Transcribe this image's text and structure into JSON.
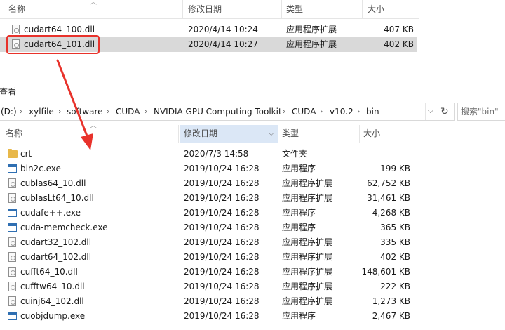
{
  "top_explorer": {
    "columns": {
      "name": "名称",
      "date": "修改日期",
      "type": "类型",
      "size": "大小"
    },
    "rows": [
      {
        "name": "cudart64_100.dll",
        "date": "2020/4/14 10:24",
        "type": "应用程序扩展",
        "size": "407 KB",
        "icon": "dll-file-icon",
        "selected": false
      },
      {
        "name": "cudart64_101.dll",
        "date": "2020/4/14 10:27",
        "type": "应用程序扩展",
        "size": "402 KB",
        "icon": "dll-file-icon",
        "selected": true
      }
    ]
  },
  "ribbon": {
    "view_label": "查看"
  },
  "address": {
    "prefix": "(D:)",
    "crumbs": [
      "xylfile",
      "software",
      "CUDA",
      "NVIDIA GPU Computing Toolkit",
      "CUDA",
      "v10.2",
      "bin"
    ],
    "search_placeholder": "搜索\"bin\""
  },
  "main_list": {
    "columns": {
      "name": "名称",
      "date": "修改日期",
      "type": "类型",
      "size": "大小"
    },
    "rows": [
      {
        "name": "crt",
        "date": "2020/7/3 14:58",
        "type": "文件夹",
        "size": "",
        "icon": "folder-icon"
      },
      {
        "name": "bin2c.exe",
        "date": "2019/10/24 16:28",
        "type": "应用程序",
        "size": "199 KB",
        "icon": "exe-icon"
      },
      {
        "name": "cublas64_10.dll",
        "date": "2019/10/24 16:28",
        "type": "应用程序扩展",
        "size": "62,752 KB",
        "icon": "dll-file-icon"
      },
      {
        "name": "cublasLt64_10.dll",
        "date": "2019/10/24 16:28",
        "type": "应用程序扩展",
        "size": "31,461 KB",
        "icon": "dll-file-icon"
      },
      {
        "name": "cudafe++.exe",
        "date": "2019/10/24 16:28",
        "type": "应用程序",
        "size": "4,268 KB",
        "icon": "exe-icon"
      },
      {
        "name": "cuda-memcheck.exe",
        "date": "2019/10/24 16:28",
        "type": "应用程序",
        "size": "365 KB",
        "icon": "exe-icon"
      },
      {
        "name": "cudart32_102.dll",
        "date": "2019/10/24 16:28",
        "type": "应用程序扩展",
        "size": "335 KB",
        "icon": "dll-file-icon"
      },
      {
        "name": "cudart64_102.dll",
        "date": "2019/10/24 16:28",
        "type": "应用程序扩展",
        "size": "402 KB",
        "icon": "dll-file-icon"
      },
      {
        "name": "cufft64_10.dll",
        "date": "2019/10/24 16:28",
        "type": "应用程序扩展",
        "size": "148,601 KB",
        "icon": "dll-file-icon"
      },
      {
        "name": "cufftw64_10.dll",
        "date": "2019/10/24 16:28",
        "type": "应用程序扩展",
        "size": "222 KB",
        "icon": "dll-file-icon"
      },
      {
        "name": "cuinj64_102.dll",
        "date": "2019/10/24 16:28",
        "type": "应用程序扩展",
        "size": "1,273 KB",
        "icon": "dll-file-icon"
      },
      {
        "name": "cuobjdump.exe",
        "date": "2019/10/24 16:28",
        "type": "应用程序",
        "size": "2,467 KB",
        "icon": "exe-icon"
      }
    ]
  },
  "colors": {
    "annotation_red": "#e8322b",
    "selected_row": "#d9d9d9",
    "sorted_header": "#dbe7f6"
  }
}
